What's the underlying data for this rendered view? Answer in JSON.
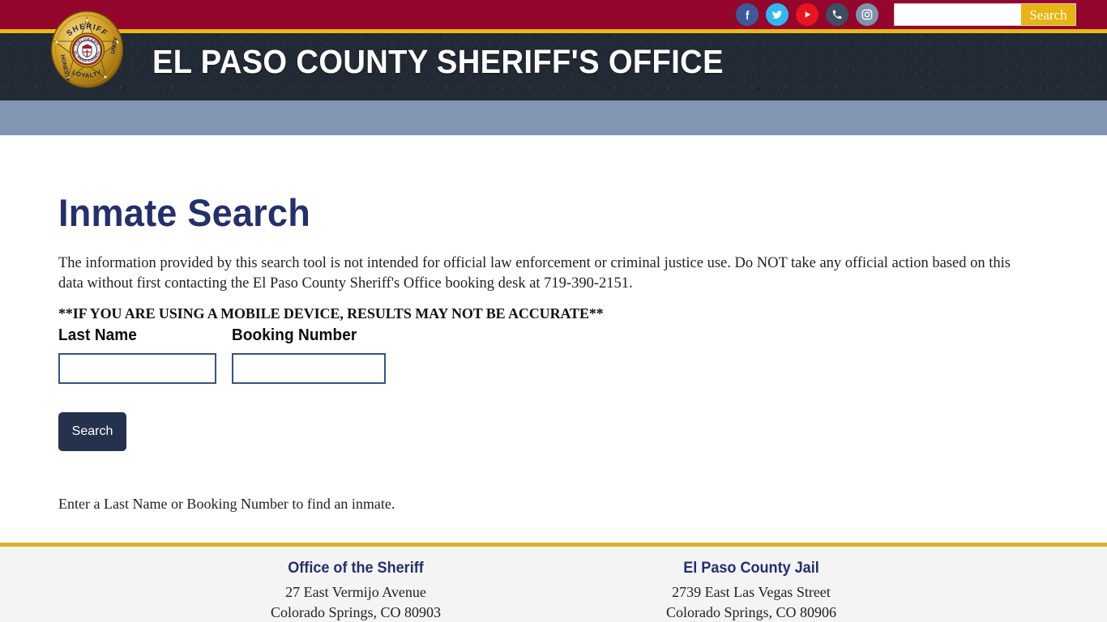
{
  "topbar": {
    "background_color": "#95062c",
    "social": [
      {
        "name": "facebook-icon",
        "label": "Facebook",
        "color": "#3b5a9b"
      },
      {
        "name": "twitter-icon",
        "label": "Twitter",
        "color": "#2fb8ef"
      },
      {
        "name": "youtube-icon",
        "label": "YouTube",
        "color": "#e8151f"
      },
      {
        "name": "phone-icon",
        "label": "Phone",
        "color": "#3d4f60"
      },
      {
        "name": "instagram-icon",
        "label": "Instagram",
        "color": "#7d93a8"
      }
    ],
    "search": {
      "value": "",
      "placeholder": "",
      "button_label": "Search",
      "button_color": "#e7b511"
    }
  },
  "masthead": {
    "title": "EL PASO COUNTY SHERIFF'S OFFICE",
    "badge": {
      "name": "sheriff-badge",
      "top_text": "SHERIFF",
      "state_text": "COLORADO",
      "county_text": "EL PASO COUNTY",
      "left_text": "HONESTY",
      "right_text": "UNITY",
      "bottom_text": "LOYALTY",
      "color": "#d9a21b"
    },
    "gold_stripe_color": "#e9b81a",
    "background_color": "#222a35"
  },
  "navbar": {
    "background_color": "#8295b3"
  },
  "main": {
    "page_title": "Inmate Search",
    "title_color": "#23306b",
    "disclaimer": "The information provided by this search tool is not intended for official law enforcement or criminal justice use. Do NOT take any official action based on this data without first contacting the El Paso County Sheriff's Office booking desk at 719-390-2151.",
    "mobile_warning": "**IF YOU ARE USING A MOBILE DEVICE, RESULTS MAY NOT BE ACCURATE**",
    "form": {
      "last_name": {
        "label": "Last Name",
        "value": "",
        "placeholder": ""
      },
      "booking_number": {
        "label": "Booking Number",
        "value": "",
        "placeholder": ""
      },
      "submit_label": "Search",
      "submit_color": "#25324d"
    },
    "hint": "Enter a Last Name or Booking Number to find an inmate."
  },
  "footer": {
    "divider_color": "#d6b42a",
    "background_color": "#f4f4f5",
    "columns": [
      {
        "heading": "Office of the Sheriff",
        "address_line1": "27 East Vermijo Avenue",
        "address_line2": "Colorado Springs, CO 80903"
      },
      {
        "heading": "El Paso County Jail",
        "address_line1": "2739 East Las Vegas Street",
        "address_line2": "Colorado Springs, CO 80906"
      }
    ]
  }
}
